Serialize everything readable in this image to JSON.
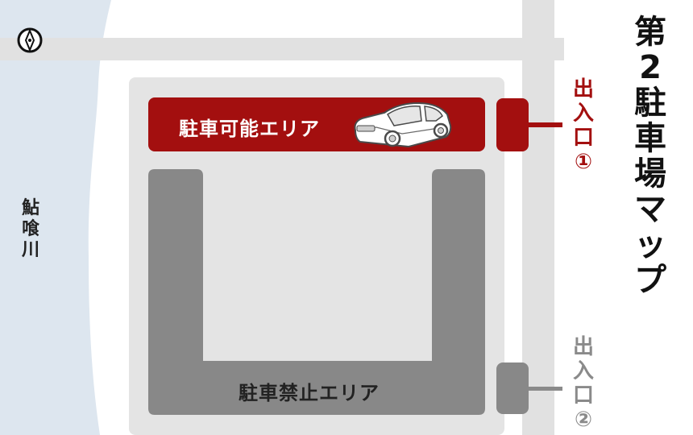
{
  "title": [
    "第",
    "2",
    "駐",
    "車",
    "場",
    "マ",
    "ッ",
    "プ"
  ],
  "river": [
    "鮎",
    "喰",
    "川"
  ],
  "zones": {
    "parking": "駐車可能エリア",
    "no_parking": "駐車禁止エリア"
  },
  "entrances": [
    {
      "chars": [
        "出",
        "入",
        "口",
        "①"
      ],
      "color": "#a30f0f"
    },
    {
      "chars": [
        "出",
        "入",
        "口",
        "②"
      ],
      "color": "#8a8a8a"
    }
  ],
  "icons": [
    "compass-icon",
    "car-icon"
  ],
  "colors": {
    "river": "#dde6ef",
    "road": "#e1e1e1",
    "lot": "#e4e4e4",
    "parking_zone": "#a30f0f",
    "no_parking_zone": "#888888",
    "entrance_connector_2": "#8a8a8a"
  }
}
